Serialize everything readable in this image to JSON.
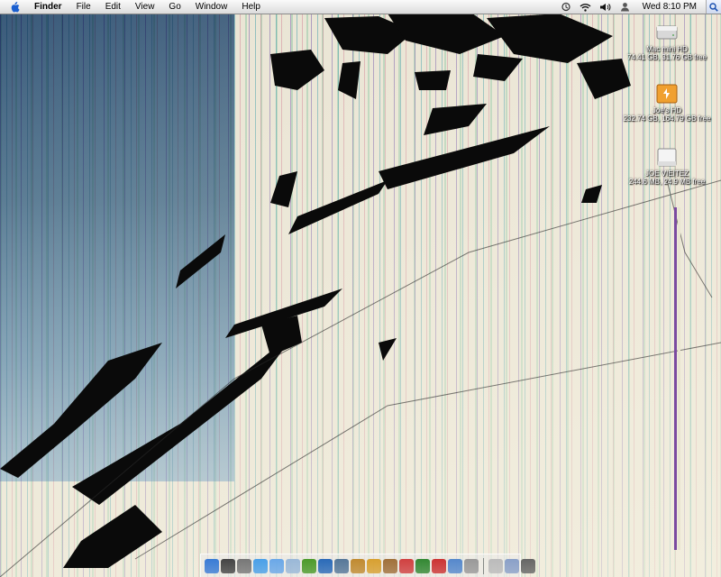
{
  "menubar": {
    "apple_icon": "apple-icon",
    "app_name": "Finder",
    "menus": [
      "File",
      "Edit",
      "View",
      "Go",
      "Window",
      "Help"
    ],
    "status_icons": [
      "timemachine-icon",
      "wifi-icon",
      "volume-icon",
      "user-icon"
    ],
    "clock": "Wed 8:10 PM",
    "spotlight_icon": "spotlight-icon"
  },
  "desktop_icons": [
    {
      "name": "Mac mini HD",
      "info": "74.41 GB, 31.76 GB free",
      "icon": "internal-disk-icon"
    },
    {
      "name": "Joe's HD",
      "info": "232.74 GB, 164.79 GB free",
      "icon": "external-firewire-disk-icon"
    },
    {
      "name": "JOE VIEITEZ",
      "info": "244.6 MB, 24.9 MB free",
      "icon": "usb-disk-icon"
    }
  ],
  "dock": {
    "apps": [
      {
        "icon": "finder-icon",
        "color": "#3a7bd5"
      },
      {
        "icon": "dashboard-icon",
        "color": "#444444"
      },
      {
        "icon": "system-preferences-icon",
        "color": "#777777"
      },
      {
        "icon": "safari-icon",
        "color": "#4aa0e8"
      },
      {
        "icon": "ichat-icon",
        "color": "#6aa8e8"
      },
      {
        "icon": "mail-icon",
        "color": "#9ab8d8"
      },
      {
        "icon": "itunes-icon",
        "color": "#4c9a2a"
      },
      {
        "icon": "quicktime-icon",
        "color": "#2a6ab8"
      },
      {
        "icon": "iphoto-icon",
        "color": "#557799"
      },
      {
        "icon": "imovie-icon",
        "color": "#c08a30"
      },
      {
        "icon": "garageband-icon",
        "color": "#d8a030"
      },
      {
        "icon": "address-book-icon",
        "color": "#a0703a"
      },
      {
        "icon": "ical-icon",
        "color": "#d04040"
      },
      {
        "icon": "cyberduck-icon",
        "color": "#338833"
      },
      {
        "icon": "sticky-icon",
        "color": "#cc3333"
      },
      {
        "icon": "preview-icon",
        "color": "#5588cc"
      },
      {
        "icon": "network-icon",
        "color": "#999999"
      }
    ],
    "docs": [
      {
        "icon": "documents-folder-icon",
        "color": "#bbbbbb"
      },
      {
        "icon": "downloads-stack-icon",
        "color": "#8aa0c8"
      },
      {
        "icon": "trash-icon",
        "color": "#666666"
      }
    ]
  }
}
